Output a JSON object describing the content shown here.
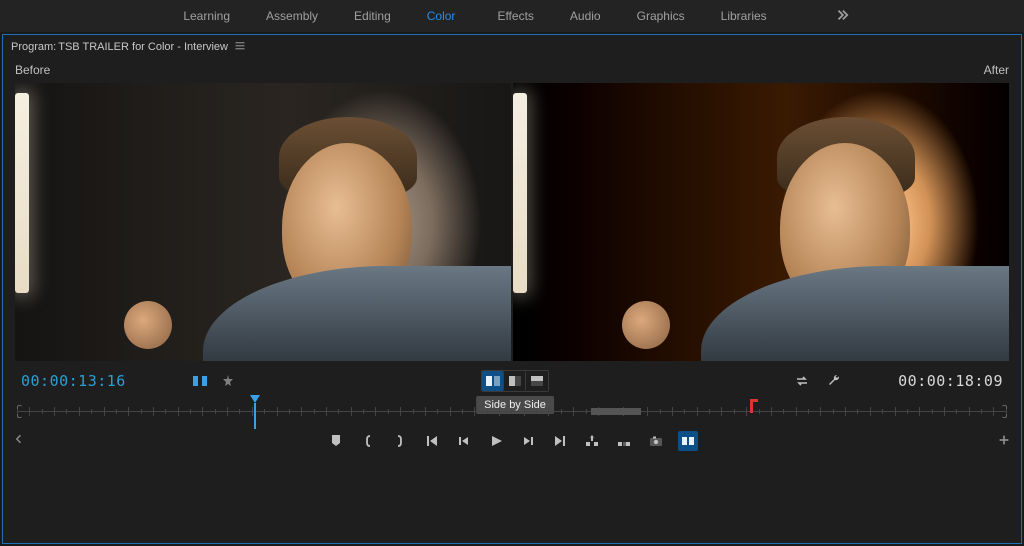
{
  "workspace": {
    "tabs": [
      "Learning",
      "Assembly",
      "Editing",
      "Color",
      "Effects",
      "Audio",
      "Graphics",
      "Libraries"
    ],
    "active_index": 3
  },
  "panel": {
    "title_prefix": "Program: ",
    "title": "TSB TRAILER for Color - Interview"
  },
  "compare": {
    "before_label": "Before",
    "after_label": "After",
    "tooltip": "Side by Side"
  },
  "timecode": {
    "current": "00:00:13:16",
    "duration": "00:00:18:09"
  },
  "timeline": {
    "playhead_pct": 24,
    "in_marker_pct": 74,
    "clip_gap_left_pct": 58,
    "clip_gap_width_pct": 5
  },
  "icons": {
    "menu": "menu-icon",
    "overflow": "chevrons-right-icon",
    "compare_toggle": "compare-toggle-icon",
    "safe_margins": "safe-margins-icon",
    "side_by_side": "side-by-side-icon",
    "split_vert": "split-vertical-icon",
    "split_horiz": "split-horizontal-icon",
    "swap": "swap-icon",
    "wrench": "settings-wrench-icon",
    "marker": "add-marker-icon",
    "in_point": "mark-in-icon",
    "out_point": "mark-out-icon",
    "go_in": "go-to-in-icon",
    "step_back": "step-back-icon",
    "play": "play-icon",
    "step_fwd": "step-forward-icon",
    "go_out": "go-to-out-icon",
    "lift": "lift-icon",
    "extract": "extract-icon",
    "export_frame": "export-frame-icon",
    "compare_view": "comparison-view-icon",
    "plus": "plus-icon"
  }
}
